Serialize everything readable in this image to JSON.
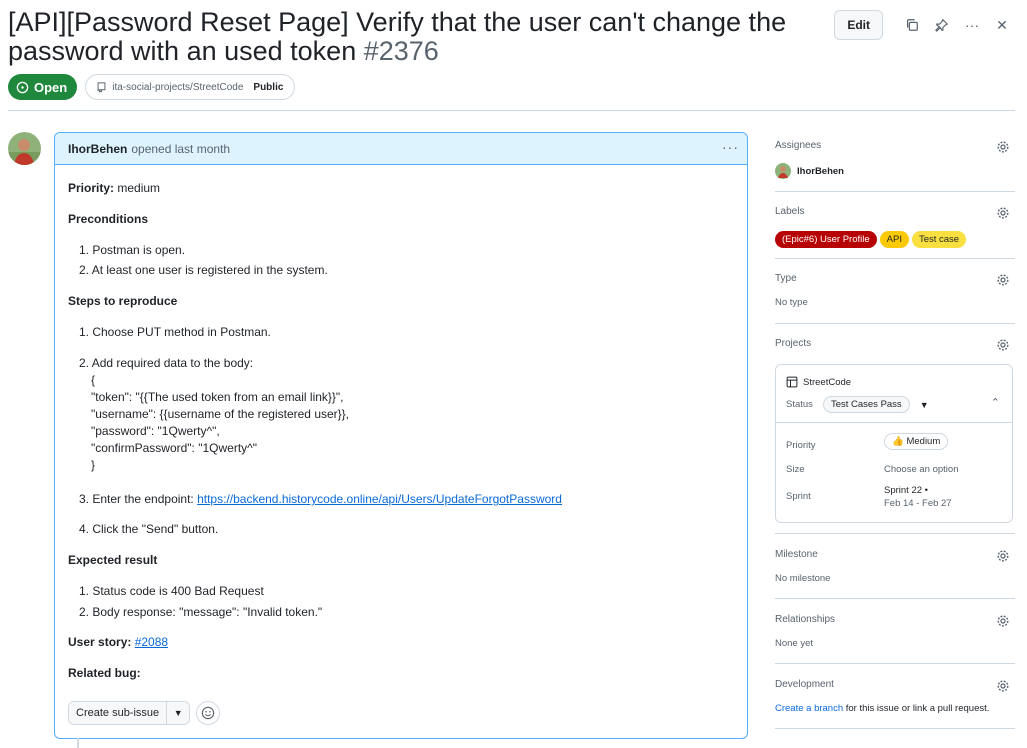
{
  "issue": {
    "title_line1": "[API][Password Reset Page] Verify that the user can't change the",
    "title_line2": "password with an used token",
    "number": "#2376",
    "state": "Open",
    "repo": "ita-social-projects/StreetCode",
    "visibility": "Public"
  },
  "actions": {
    "edit_label": "Edit"
  },
  "comment": {
    "author": "IhorBehen",
    "meta": "opened last month",
    "priority_label": "Priority:",
    "priority_value": " medium",
    "preconditions_heading": "Preconditions",
    "preconditions": [
      "Postman is open.",
      "At least one user is registered in the system."
    ],
    "steps_heading": "Steps to reproduce",
    "step1": "Choose PUT method in Postman.",
    "step2": "Add required data to the body:",
    "body_lines": [
      "{",
      "\"token\": \"{{The used token from an email link}}\",",
      "\"username\": {{username of the registered user}},",
      "\"password\": \"1Qwerty^\",",
      "\"confirmPassword\": \"1Qwerty^\"",
      "}"
    ],
    "step3_prefix": "Enter the endpoint: ",
    "step3_link": "https://backend.historycode.online/api/Users/UpdateForgotPassword",
    "step4": "Click the \"Send\" button.",
    "expected_heading": "Expected result",
    "expected": [
      "Status code is 400 Bad Request",
      "Body response: \"message\": \"Invalid token.\""
    ],
    "user_story_label": "User story: ",
    "user_story_link": "#2088",
    "related_bug_label": "Related bug:",
    "create_sub_issue": "Create sub-issue"
  },
  "sidebar": {
    "assignees_title": "Assignees",
    "assignee": "IhorBehen",
    "labels_title": "Labels",
    "labels": [
      {
        "text": "(Epic#6) User Profile",
        "bg": "#b60205",
        "fg": "#ffffff"
      },
      {
        "text": "API",
        "bg": "#fbca04",
        "fg": "#1f2328"
      },
      {
        "text": "Test case",
        "bg": "#f9e040",
        "fg": "#1f2328"
      }
    ],
    "type_title": "Type",
    "type_value": "No type",
    "projects_title": "Projects",
    "project_name": "StreetCode",
    "status_label": "Status",
    "status_value": "Test Cases Pass",
    "priority_label": "Priority",
    "priority_value": "Medium",
    "size_label": "Size",
    "size_value": "Choose an option",
    "sprint_label": "Sprint",
    "sprint_value": "Sprint 22 •",
    "sprint_dates": "Feb 14 - Feb 27",
    "milestone_title": "Milestone",
    "milestone_value": "No milestone",
    "relationships_title": "Relationships",
    "relationships_value": "None yet",
    "development_title": "Development",
    "development_link": "Create a branch",
    "development_rest": " for this issue or link a pull request."
  },
  "colors": {
    "open_green": "#1f883d",
    "link_blue": "#0969da",
    "comment_border": "#54aeff"
  }
}
